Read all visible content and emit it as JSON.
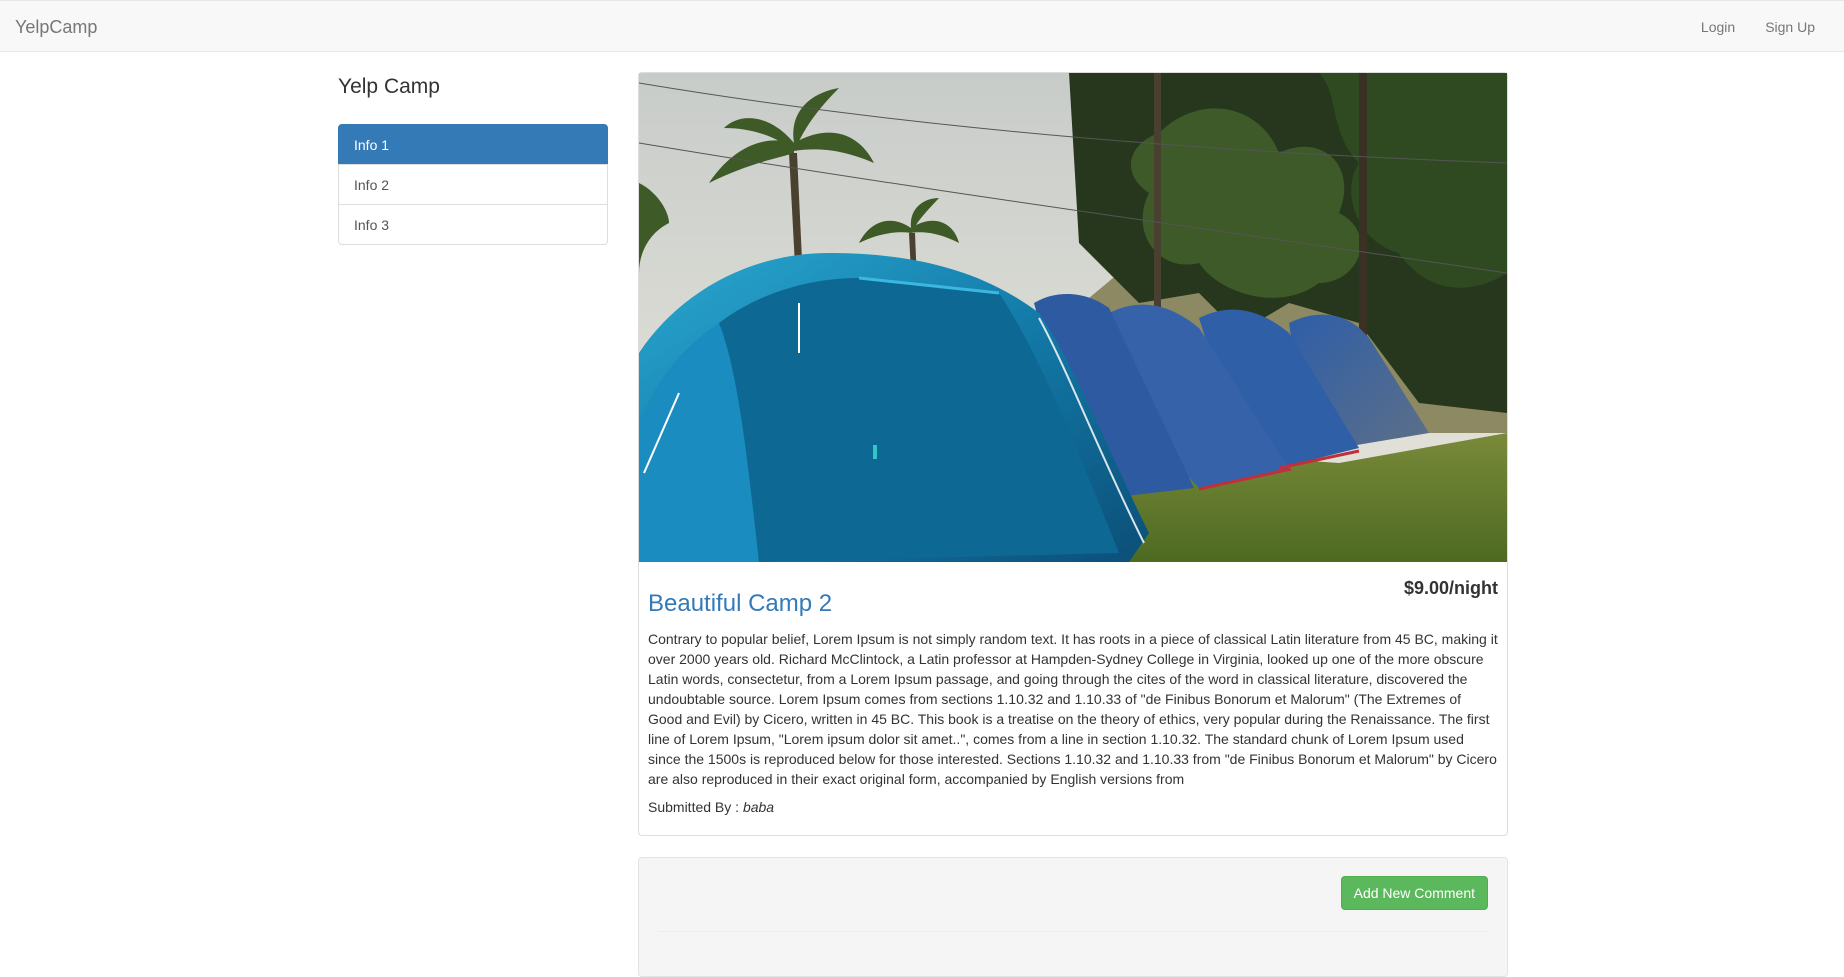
{
  "navbar": {
    "brand": "YelpCamp",
    "links": [
      "Login",
      "Sign Up"
    ]
  },
  "sidebar": {
    "title": "Yelp Camp",
    "items": [
      {
        "label": "Info 1",
        "active": true
      },
      {
        "label": "Info 2",
        "active": false
      },
      {
        "label": "Info 3",
        "active": false
      }
    ]
  },
  "campground": {
    "image": "tents-on-grass-photo",
    "name": "Beautiful Camp 2",
    "price": "$9.00/night",
    "description": "Contrary to popular belief, Lorem Ipsum is not simply random text. It has roots in a piece of classical Latin literature from 45 BC, making it over 2000 years old. Richard McClintock, a Latin professor at Hampden-Sydney College in Virginia, looked up one of the more obscure Latin words, consectetur, from a Lorem Ipsum passage, and going through the cites of the word in classical literature, discovered the undoubtable source. Lorem Ipsum comes from sections 1.10.32 and 1.10.33 of \"de Finibus Bonorum et Malorum\" (The Extremes of Good and Evil) by Cicero, written in 45 BC. This book is a treatise on the theory of ethics, very popular during the Renaissance. The first line of Lorem Ipsum, \"Lorem ipsum dolor sit amet..\", comes from a line in section 1.10.32. The standard chunk of Lorem Ipsum used since the 1500s is reproduced below for those interested. Sections 1.10.32 and 1.10.33 from \"de Finibus Bonorum et Malorum\" by Cicero are also reproduced in their exact original form, accompanied by English versions from",
    "submitted_label": "Submitted By :",
    "author": "baba"
  },
  "comments": {
    "add_button": "Add New Comment"
  },
  "colors": {
    "primary": "#337ab7",
    "success": "#5cb85c"
  }
}
